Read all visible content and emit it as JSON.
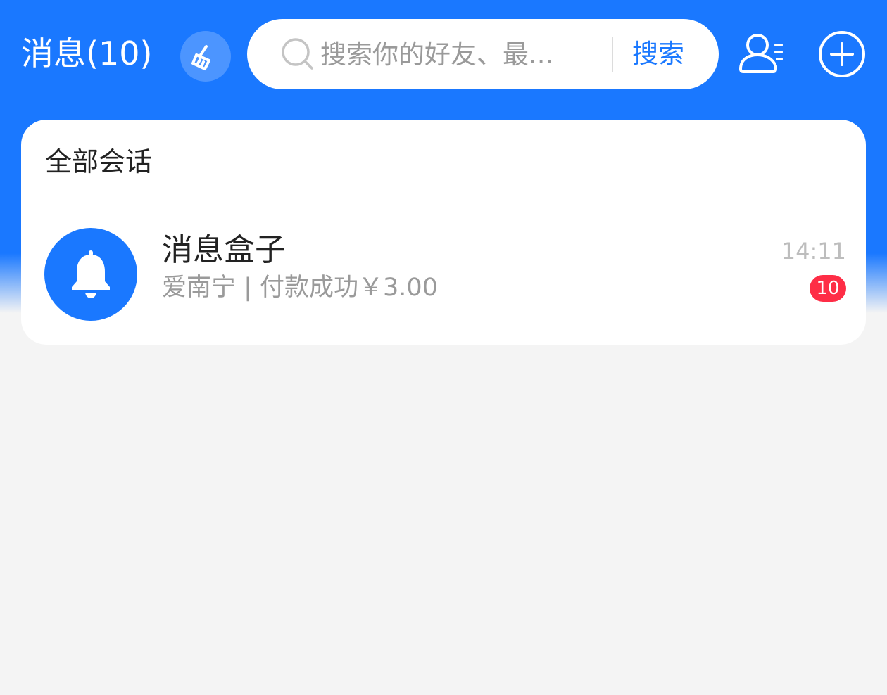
{
  "header": {
    "title": "消息(10)",
    "clean_icon": "broom-icon",
    "search": {
      "placeholder": "搜索你的好友、最...",
      "value": "",
      "icon": "search-icon",
      "button_label": "搜索"
    },
    "contacts_icon": "contacts-icon",
    "add_icon": "plus-circle-icon"
  },
  "colors": {
    "primary": "#1a78ff",
    "background": "#f4f4f4",
    "badge": "#fe2d46"
  },
  "section": {
    "title": "全部会话"
  },
  "conversations": [
    {
      "name": "消息盒子",
      "preview": "爱南宁 | 付款成功￥3.00",
      "time": "14:11",
      "unread": "10",
      "icon": "bell-icon"
    }
  ]
}
